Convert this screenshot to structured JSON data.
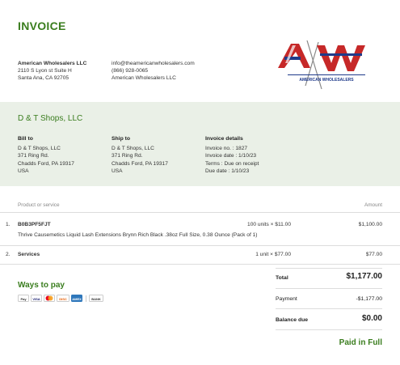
{
  "title": "INVOICE",
  "seller": {
    "name": "American Wholesalers LLC",
    "address1": "2110 S Lyon st Suite H",
    "address2": "Santa Ana, CA 92705",
    "email": "info@theamericanwholesalers.com",
    "phone": "(866) 928-0065",
    "company": "American Wholesalers LLC"
  },
  "logo": {
    "letters": "AW",
    "tagline": "AMERICAN WHOLESALERS",
    "colors": {
      "red": "#c62828",
      "blue": "#1f3a8a"
    }
  },
  "client": {
    "name": "D & T Shops, LLC",
    "bill_to": {
      "heading": "Bill to",
      "lines": [
        "D & T Shops, LLC",
        "371 Ring Rd.",
        "Chadds Ford, PA 19317",
        "USA"
      ]
    },
    "ship_to": {
      "heading": "Ship to",
      "lines": [
        "D & T Shops, LLC",
        "371 Ring Rd.",
        "Chadds Ford, PA 19317",
        "USA"
      ]
    },
    "details": {
      "heading": "Invoice details",
      "lines": [
        "Invoice no. : 1827",
        "Invoice date : 1/10/23",
        "Terms : Due on receipt",
        "Due date : 1/10/23"
      ]
    }
  },
  "table": {
    "col_product": "Product or service",
    "col_amount": "Amount",
    "items": [
      {
        "num": "1.",
        "name": "B0B3PF5FJT",
        "qty": "100 units × $11.00",
        "amount": "$1,100.00",
        "desc": "Thrive Causemetics Liquid Lash Extensions Brynn Rich Black .38oz Full Size, 0.38 Ounce (Pack of 1)"
      },
      {
        "num": "2.",
        "name": "Services",
        "qty": "1 unit × $77.00",
        "amount": "$77.00",
        "desc": ""
      }
    ]
  },
  "payment": {
    "heading": "Ways to pay",
    "methods": [
      "Pay",
      "VISA",
      "MC",
      "DISC",
      "AMEX",
      "BANK"
    ]
  },
  "totals": {
    "total_label": "Total",
    "total_value": "$1,177.00",
    "payment_label": "Payment",
    "payment_value": "-$1,177.00",
    "balance_label": "Balance due",
    "balance_value": "$0.00",
    "status": "Paid in Full"
  },
  "colors": {
    "accent": "#3a7d1e",
    "band": "#eaf0e7"
  }
}
